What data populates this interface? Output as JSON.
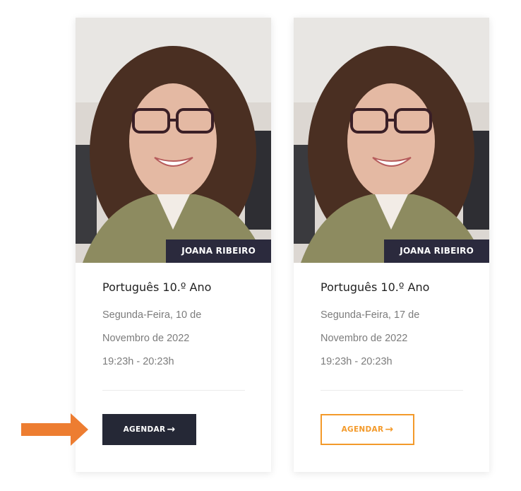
{
  "cards": [
    {
      "tutor_name": "JOANA RIBEIRO",
      "course_title": "Português 10.º Ano",
      "date_line1": "Segunda-Feira, 10 de",
      "date_line2": "Novembro de 2022",
      "time": "19:23h - 20:23h",
      "button_label": "AGENDAR",
      "button_style": "filled-dark"
    },
    {
      "tutor_name": "JOANA RIBEIRO",
      "course_title": "Português 10.º Ano",
      "date_line1": "Segunda-Feira, 17 de",
      "date_line2": "Novembro de 2022",
      "time": "19:23h - 20:23h",
      "button_label": "AGENDAR",
      "button_style": "outline-orange"
    }
  ],
  "icons": {
    "button_arrow": "arrow-right-icon",
    "annotation_arrow": "orange-pointer-arrow"
  },
  "colors": {
    "dark": "#252836",
    "accent_orange": "#f39a2b",
    "text_gray": "#7c7c7c"
  }
}
